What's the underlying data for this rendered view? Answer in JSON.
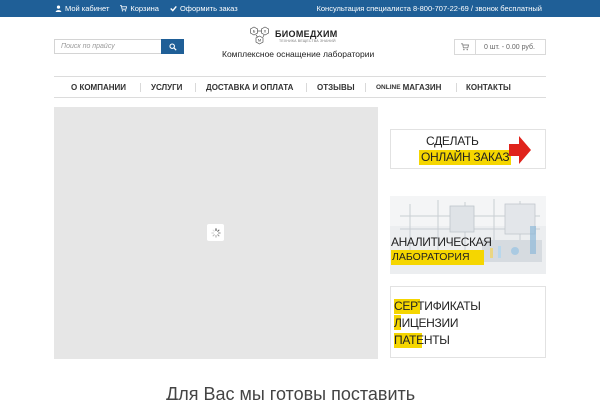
{
  "topbar": {
    "links": [
      {
        "label": "Мой кабинет",
        "icon": "user-icon"
      },
      {
        "label": "Корзина",
        "icon": "cart-icon"
      },
      {
        "label": "Оформить заказ",
        "icon": "check-icon"
      }
    ],
    "consult": "Консультация специалиста 8-800-707-22-69 / звонок бесплатный",
    "color": "#1f5f97"
  },
  "search": {
    "placeholder": "Поиск по прайсу",
    "icon": "search-icon"
  },
  "logo": {
    "name": "БИОМЕДХИМ",
    "sub": "ТЕХНИКА ВЕЩЕСТВА ЗНАНИЙ",
    "letters": [
      "Б",
      "Х",
      "М"
    ]
  },
  "tagline": "Комплексное оснащение лаборатории",
  "cart": {
    "text": "0 шт. - 0.00 руб.",
    "icon": "cart-icon"
  },
  "nav": {
    "items": [
      {
        "label": "О КОМПАНИИ"
      },
      {
        "label": "УСЛУГИ"
      },
      {
        "label": "ДОСТАВКА И ОПЛАТА"
      },
      {
        "label": "ОТЗЫВЫ"
      },
      {
        "prefix": "ONLINE",
        "label": "МАГАЗИН"
      },
      {
        "label": "КОНТАКТЫ"
      }
    ]
  },
  "banners": {
    "order": {
      "line1": "СДЕЛАТЬ",
      "line2": "ОНЛАЙН ЗАКАЗ"
    },
    "lab": {
      "line1": "АНАЛИТИЧЕСКАЯ",
      "line2": "ЛАБОРАТОРИЯ"
    },
    "certs": {
      "line1": "СЕРТИФИКАТЫ",
      "line2": "ЛИЦЕНЗИИ",
      "line3": "ПАТЕНТЫ"
    }
  },
  "bottom_title": "Для Вас мы готовы поставить",
  "accent_colors": {
    "yellow": "#f5d600",
    "red": "#e0231c",
    "blue": "#1f5f97"
  }
}
